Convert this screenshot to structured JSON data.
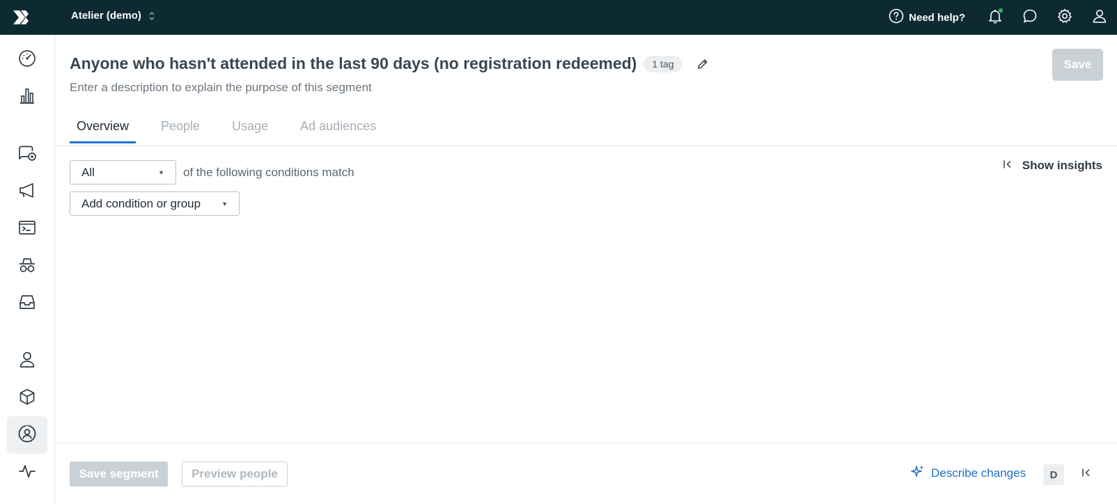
{
  "topbar": {
    "workspace": "Atelier (demo)",
    "help_label": "Need help?",
    "icons": [
      "logo-icon",
      "help-icon",
      "bell-icon",
      "chat-icon",
      "gear-icon",
      "user-icon"
    ],
    "notification_dot_color": "#2fbf4f"
  },
  "sidebar": {
    "items": [
      {
        "name": "dashboard-icon"
      },
      {
        "name": "analytics-icon"
      },
      {
        "name": "campaigns-icon"
      },
      {
        "name": "broadcasts-icon"
      },
      {
        "name": "transactional-icon"
      },
      {
        "name": "spy-icon"
      },
      {
        "name": "inbox-icon"
      },
      {
        "name": "people-icon"
      },
      {
        "name": "objects-icon"
      },
      {
        "name": "segments-icon",
        "active": true
      },
      {
        "name": "activity-icon"
      }
    ]
  },
  "segment": {
    "title": "Anyone who hasn't attended in the last 90 days (no registration redeemed)",
    "tag_badge": "1 tag",
    "description_placeholder": "Enter a description to explain the purpose of this segment",
    "save_label": "Save"
  },
  "tabs": [
    {
      "label": "Overview",
      "active": true
    },
    {
      "label": "People"
    },
    {
      "label": "Usage"
    },
    {
      "label": "Ad audiences"
    }
  ],
  "conditions": {
    "match_value": "All",
    "match_text": "of the following conditions match",
    "add_label": "Add condition or group",
    "insights_label": "Show insights"
  },
  "footer": {
    "save_segment_label": "Save segment",
    "preview_label": "Preview people",
    "describe_label": "Describe changes",
    "shortcut": "D"
  },
  "colors": {
    "topbar": "#0d2a33",
    "accent": "#1e74d6",
    "link": "#1e6fc8",
    "disabled_button": "#c9d1d6"
  }
}
